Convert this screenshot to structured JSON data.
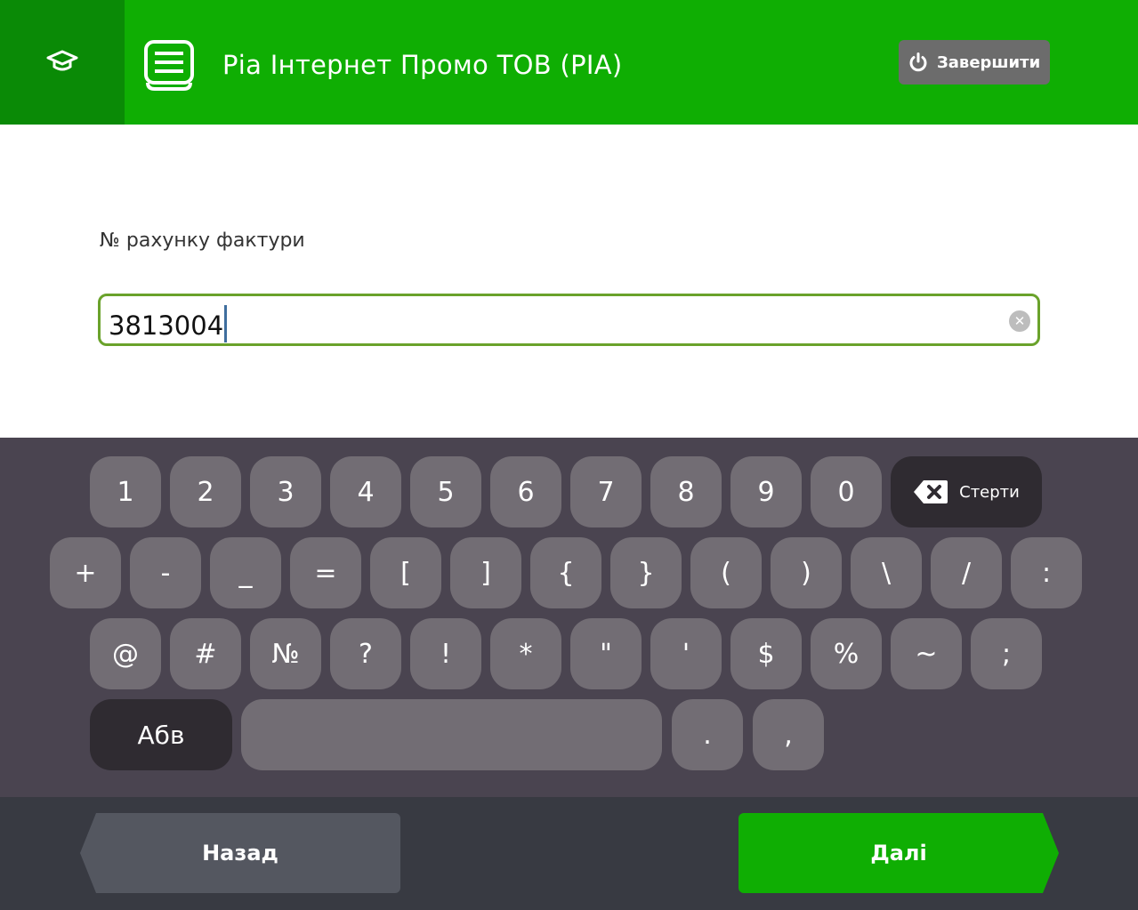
{
  "header": {
    "title": "Ріа Інтернет Промо ТОВ (РІА)",
    "finish_label": "Завершити",
    "edu_icon": "graduation-cap-icon",
    "menu_icon": "list-icon",
    "colors": {
      "bar": "#0fae03",
      "edu_block": "#0a8a06"
    }
  },
  "form": {
    "label": "№ рахунку фактури",
    "value": "3813004",
    "clear_icon": "clear-icon"
  },
  "keyboard": {
    "row1": [
      "1",
      "2",
      "3",
      "4",
      "5",
      "6",
      "7",
      "8",
      "9",
      "0"
    ],
    "backspace_label": "Стерти",
    "row2": [
      "+",
      "-",
      "_",
      "=",
      "[",
      "]",
      "{",
      "}",
      "(",
      ")",
      "\\",
      "/",
      ":"
    ],
    "row3": [
      "@",
      "#",
      "№",
      "?",
      "!",
      "*",
      "\"",
      "'",
      "$",
      "%",
      "~",
      ";"
    ],
    "layout_switch_label": "Абв",
    "row4_punct": [
      ".",
      ","
    ]
  },
  "nav": {
    "back_label": "Назад",
    "next_label": "Далі"
  }
}
